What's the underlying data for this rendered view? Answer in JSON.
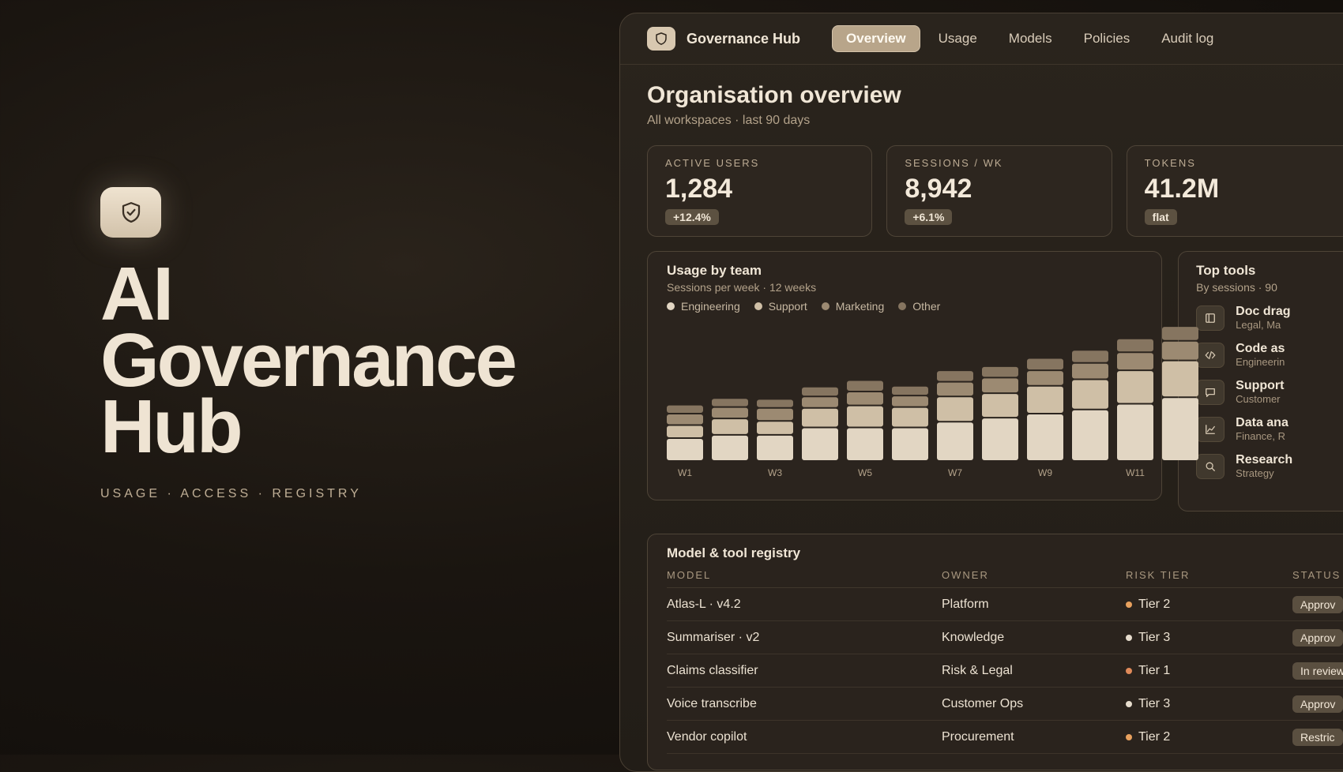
{
  "hero": {
    "title_lines": [
      "AI",
      "Governance",
      "Hub"
    ],
    "subtitle": "USAGE · ACCESS · REGISTRY"
  },
  "app": {
    "brand": "Governance Hub",
    "tabs": [
      {
        "label": "Overview",
        "active": true
      },
      {
        "label": "Usage",
        "active": false
      },
      {
        "label": "Models",
        "active": false
      },
      {
        "label": "Policies",
        "active": false
      },
      {
        "label": "Audit log",
        "active": false
      }
    ]
  },
  "page": {
    "title": "Organisation overview",
    "subtitle": "All workspaces · last 90 days"
  },
  "kpis": [
    {
      "label": "ACTIVE USERS",
      "value": "1,284",
      "change": "+12.4%"
    },
    {
      "label": "SESSIONS / WK",
      "value": "8,942",
      "change": "+6.1%"
    },
    {
      "label": "TOKENS",
      "value": "41.2M",
      "change": "flat"
    }
  ],
  "usage_chart": {
    "title": "Usage by team",
    "subtitle": "Sessions per week · 12 weeks"
  },
  "chart_data": {
    "type": "bar",
    "stacked": true,
    "categories": [
      "W1",
      "W2",
      "W3",
      "W4",
      "W5",
      "W6",
      "W7",
      "W8",
      "W9",
      "W10",
      "W11",
      "W12"
    ],
    "tick_labels": [
      "W1",
      "W3",
      "W5",
      "W7",
      "W9",
      "W11"
    ],
    "series": [
      {
        "name": "Engineering",
        "color": "#e2d6c3",
        "values": [
          28,
          32,
          32,
          41,
          41,
          41,
          48,
          53,
          58,
          63,
          70,
          78
        ]
      },
      {
        "name": "Support",
        "color": "#cfbfa6",
        "values": [
          16,
          20,
          17,
          24,
          27,
          25,
          31,
          30,
          34,
          37,
          41,
          45
        ]
      },
      {
        "name": "Marketing",
        "color": "#9c8a72",
        "values": [
          14,
          14,
          16,
          14,
          17,
          14,
          18,
          19,
          19,
          20,
          22,
          24
        ]
      },
      {
        "name": "Other",
        "color": "#867560",
        "values": [
          11,
          11,
          11,
          12,
          14,
          12,
          14,
          14,
          15,
          16,
          17,
          18
        ]
      }
    ],
    "ylim": [
      0,
      170
    ]
  },
  "top_tools": {
    "title": "Top tools",
    "subtitle": "By sessions · 90",
    "items": [
      {
        "name": "Doc drag",
        "desc": "Legal, Ma",
        "icon": "document-icon"
      },
      {
        "name": "Code as",
        "desc": "Engineerin",
        "icon": "code-icon"
      },
      {
        "name": "Support",
        "desc": "Customer",
        "icon": "chat-icon"
      },
      {
        "name": "Data ana",
        "desc": "Finance, R",
        "icon": "chart-line-icon"
      },
      {
        "name": "Research",
        "desc": "Strategy",
        "icon": "search-icon"
      }
    ]
  },
  "registry": {
    "title": "Model & tool registry",
    "headers": {
      "model": "MODEL",
      "owner": "OWNER",
      "tier": "RISK TIER",
      "status": "STATUS"
    },
    "rows": [
      {
        "model": "Atlas-L · v4.2",
        "owner": "Platform",
        "tier": "Tier 2",
        "tier_color": "#e8a15e",
        "status": "Approv"
      },
      {
        "model": "Summariser · v2",
        "owner": "Knowledge",
        "tier": "Tier 3",
        "tier_color": "#e6dccd",
        "status": "Approv"
      },
      {
        "model": "Claims classifier",
        "owner": "Risk & Legal",
        "tier": "Tier 1",
        "tier_color": "#e08a5a",
        "status": "In review"
      },
      {
        "model": "Voice transcribe",
        "owner": "Customer Ops",
        "tier": "Tier 3",
        "tier_color": "#e6dccd",
        "status": "Approv"
      },
      {
        "model": "Vendor copilot",
        "owner": "Procurement",
        "tier": "Tier 2",
        "tier_color": "#e8a15e",
        "status": "Restric"
      }
    ]
  }
}
